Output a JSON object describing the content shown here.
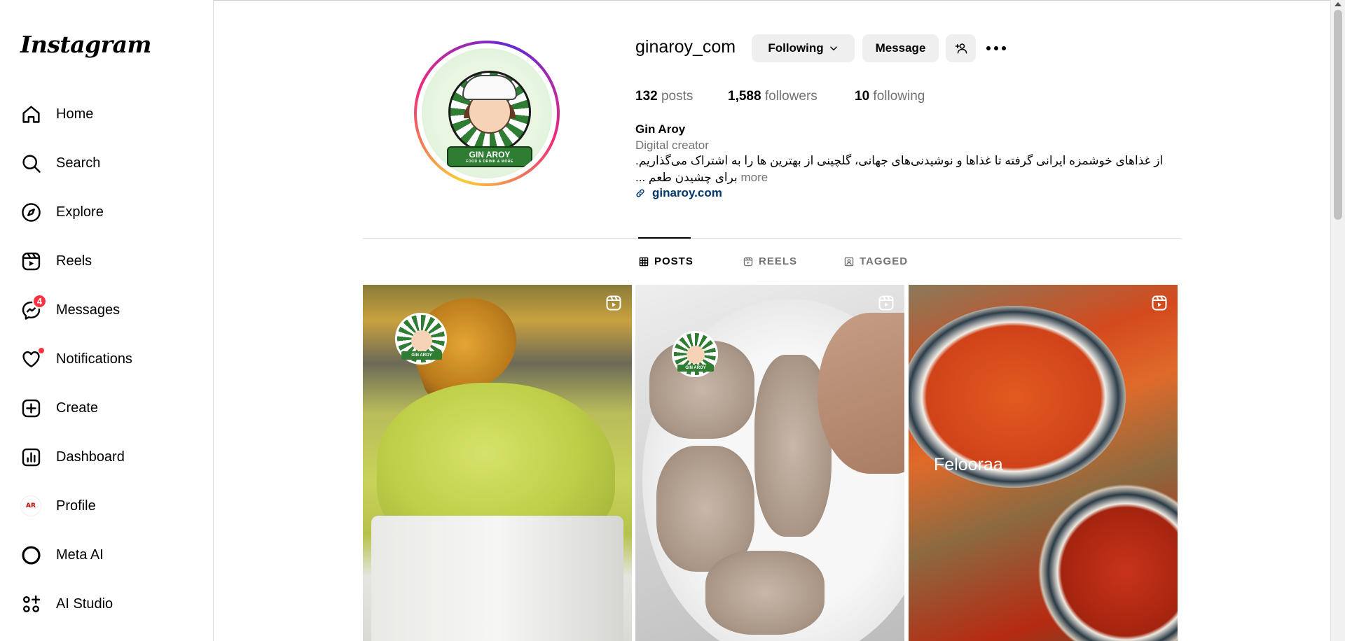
{
  "app": {
    "logo": "Instagram"
  },
  "sidebar": {
    "items": [
      {
        "label": "Home",
        "icon": "home-icon"
      },
      {
        "label": "Search",
        "icon": "search-icon"
      },
      {
        "label": "Explore",
        "icon": "compass-icon"
      },
      {
        "label": "Reels",
        "icon": "reels-icon"
      },
      {
        "label": "Messages",
        "icon": "messenger-icon",
        "badge": "4"
      },
      {
        "label": "Notifications",
        "icon": "heart-icon"
      },
      {
        "label": "Create",
        "icon": "plus-square-icon"
      },
      {
        "label": "Dashboard",
        "icon": "bar-chart-icon"
      },
      {
        "label": "Profile",
        "icon": "avatar-icon"
      },
      {
        "label": "Meta AI",
        "icon": "meta-ai-icon"
      },
      {
        "label": "AI Studio",
        "icon": "ai-studio-icon"
      }
    ],
    "profile_avatar_text": "AR"
  },
  "profile": {
    "username": "ginaroy_com",
    "following_button": "Following",
    "message_button": "Message",
    "stats": {
      "posts_count": "132",
      "posts_label": "posts",
      "followers_count": "1,588",
      "followers_label": "followers",
      "following_count": "10",
      "following_label": "following"
    },
    "full_name": "Gin Aroy",
    "category": "Digital creator",
    "bio_line1": "از غذاهای خوشمزه ایرانی گرفته تا غذاها و نوشیدنی‌های جهانی، گلچینی از بهترین ها را به اشتراک می‌گذاریم.",
    "bio_line2": "برای چشیدن طعم ...",
    "bio_more": "more",
    "link": "ginaroy.com",
    "avatar_title": "GIN AROY",
    "avatar_subtitle": "FOOD & DRINK & MORE"
  },
  "tabs": [
    {
      "label": "POSTS",
      "active": true
    },
    {
      "label": "REELS",
      "active": false
    },
    {
      "label": "TAGGED",
      "active": false
    }
  ],
  "grid": {
    "watermark_text": "GIN AROY",
    "tile3_overlay": "Felooraa"
  }
}
